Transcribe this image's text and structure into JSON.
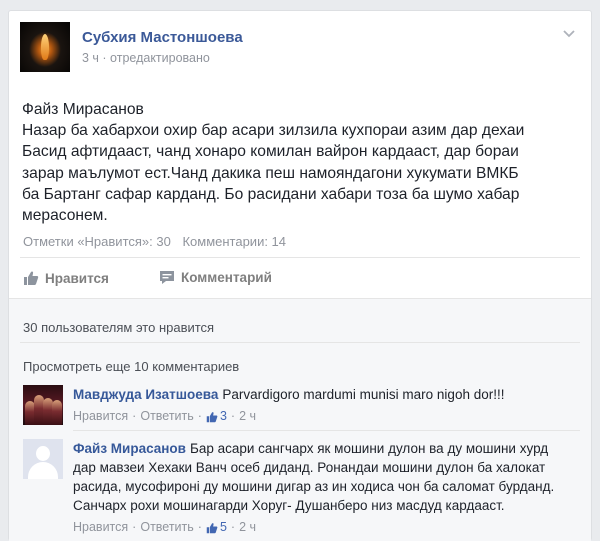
{
  "post": {
    "author": "Субхия Мастоншоева",
    "time": "3 ч",
    "edited": "отредактировано",
    "text_lines": [
      "Файз Мирасанов",
      "Назар ба хабархои охир бар асари зилзила кухпораи азим дар дехаи",
      "Басид афтидааст, чанд хонаро комилан вайрон кардааст, дар бораи",
      "зарар маълумот ест.Чанд дакика пеш намояндагони хукумати ВМКБ",
      "ба Бартанг сафар карданд. Бо расидани хабари тоза ба шумо хабар",
      "мерасонем."
    ],
    "likes_stat": "Отметки «Нравится»: 30",
    "comments_stat": "Комментарии: 14",
    "like_button": "Нравится",
    "comment_button": "Комментарий"
  },
  "feedback": {
    "likes_summary": "30 пользователям это нравится",
    "view_more": "Просмотреть еще 10 комментариев",
    "comments": [
      {
        "author": "Мавджуда Изатшоева",
        "text": "Parvardigoro mardumi munisi maro nigoh dor!!!",
        "like_label": "Нравится",
        "reply_label": "Ответить",
        "like_count": "3",
        "time": "2 ч"
      },
      {
        "author": "Файз Мирасанов",
        "text": "Бар асари сангчарх як мошини дулон ва ду мошини хурд дар мавзеи Хехаки Ванч осеб диданд. Ронандаи мошини дулон ба халокат расида, мусофиронi ду мошини дигар аз ин ходиса чон ба саломат бурданд. Санчарх рохи мошинагарди Хоруг- Душанберо низ масдуд кардааст.",
        "like_label": "Нравится",
        "reply_label": "Ответить",
        "like_count": "5",
        "time": "2 ч"
      }
    ]
  },
  "icons": {
    "chevron": "chevron-down-icon",
    "like": "thumbs-up-icon",
    "comment": "speech-bubble-icon",
    "comment_like": "small-thumbs-up-icon"
  },
  "colors": {
    "link": "#3b5998",
    "muted": "#90949c",
    "background": "#e9ebee"
  }
}
